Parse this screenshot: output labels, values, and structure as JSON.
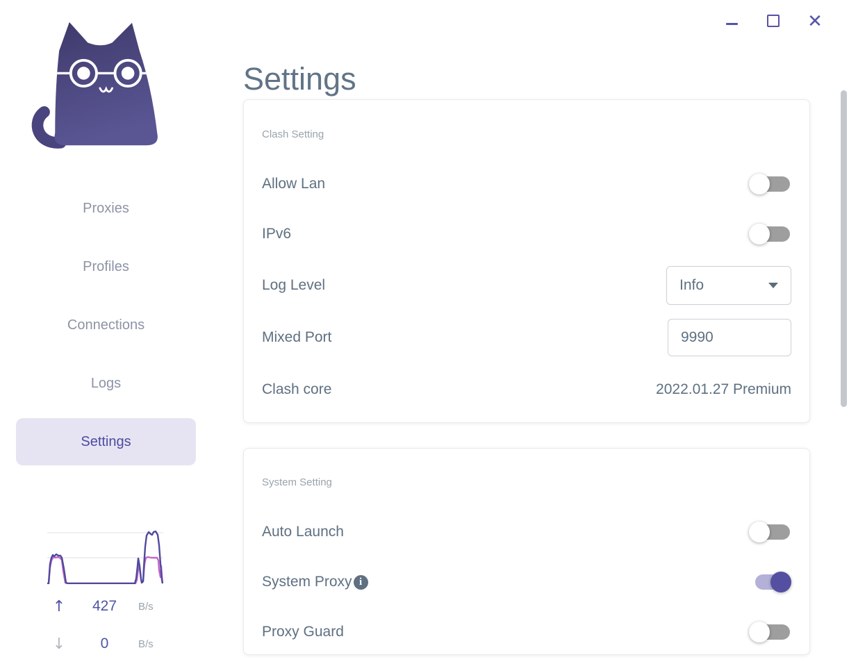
{
  "window_controls": {
    "minimize": "–",
    "maximize": "□",
    "close": "✕"
  },
  "sidebar": {
    "nav": [
      {
        "label": "Proxies",
        "active": false
      },
      {
        "label": "Profiles",
        "active": false
      },
      {
        "label": "Connections",
        "active": false
      },
      {
        "label": "Logs",
        "active": false
      },
      {
        "label": "Settings",
        "active": true
      }
    ],
    "traffic": {
      "upload": {
        "arrow": "↑",
        "value": "427",
        "unit": "B/s"
      },
      "download": {
        "arrow": "↓",
        "value": "0",
        "unit": "B/s"
      }
    }
  },
  "main": {
    "title": "Settings",
    "clash_setting": {
      "section_label": "Clash Setting",
      "allow_lan": {
        "label": "Allow Lan",
        "state": "off"
      },
      "ipv6": {
        "label": "IPv6",
        "state": "off"
      },
      "log_level": {
        "label": "Log Level",
        "value": "Info"
      },
      "mixed_port": {
        "label": "Mixed Port",
        "value": "9990"
      },
      "clash_core": {
        "label": "Clash core",
        "value": "2022.01.27 Premium"
      }
    },
    "system_setting": {
      "section_label": "System Setting",
      "auto_launch": {
        "label": "Auto Launch",
        "state": "off"
      },
      "system_proxy": {
        "label": "System Proxy",
        "state": "on",
        "info_glyph": "i"
      },
      "proxy_guard": {
        "label": "Proxy Guard",
        "state": "off"
      }
    }
  },
  "colors": {
    "accent_indigo": "#5553a8",
    "nav_active_bg": "#e6e4f2",
    "nav_active_text": "#4c4aa0",
    "nav_inactive_text": "#8d93a5",
    "label_text": "#5e7081",
    "section_text": "#9aa3ab",
    "toggle_off_track": "#9e9e9e",
    "toggle_on_track": "#b3b1d8",
    "toggle_on_knob": "#544fa1",
    "graph_upload_line": "#4f4a9c",
    "graph_download_line": "#c465c9",
    "traffic_value_text": "#4f55a7"
  }
}
